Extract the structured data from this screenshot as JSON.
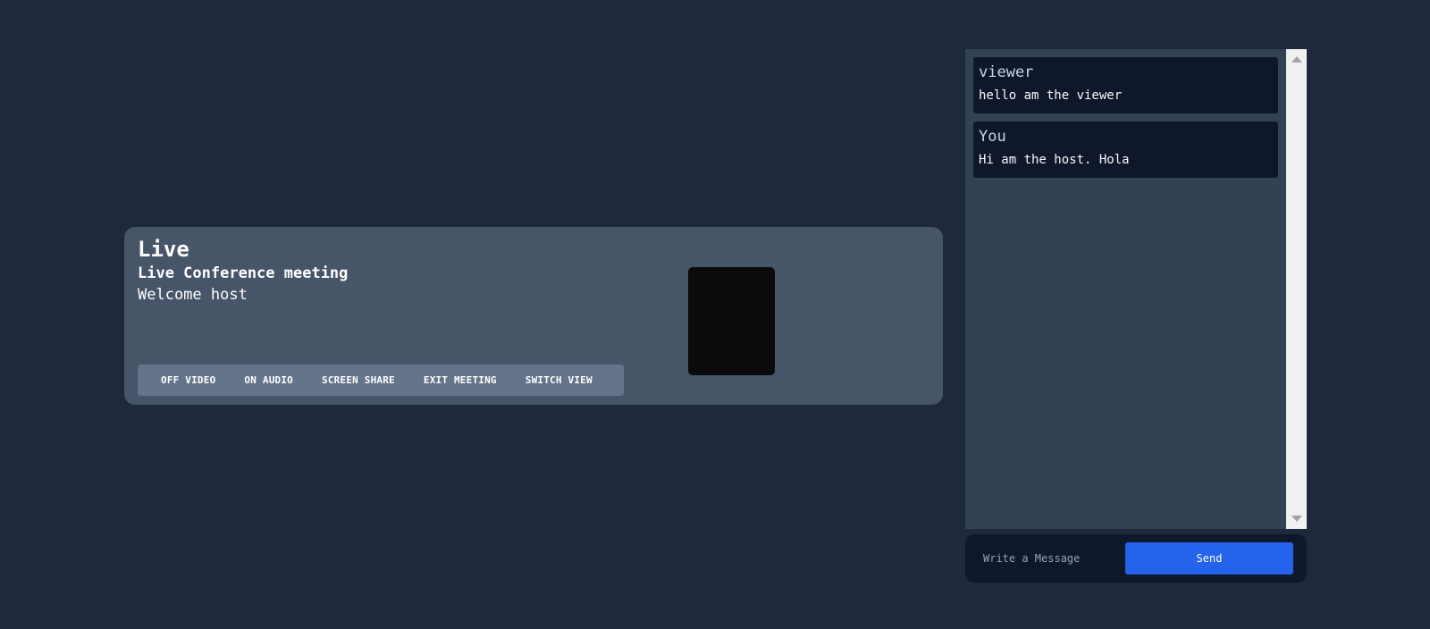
{
  "meeting": {
    "title": "Live",
    "subtitle": "Live Conference meeting",
    "welcome": "Welcome host",
    "controls": {
      "video": "OFF VIDEO",
      "audio": "ON AUDIO",
      "screen_share": "SCREEN SHARE",
      "exit": "EXIT MEETING",
      "switch_view": "SWITCH VIEW"
    }
  },
  "chat": {
    "messages": [
      {
        "author": "viewer",
        "text": "hello am the viewer"
      },
      {
        "author": "You",
        "text": "Hi am the host. Hola"
      }
    ],
    "input_placeholder": "Write a Message",
    "send_label": "Send"
  },
  "colors": {
    "page_background": "#1e293b",
    "meeting_card": "#475569",
    "controls_bar": "#64748b",
    "chat_panel": "#334155",
    "message_card": "#0f172a",
    "send_button": "#2563eb"
  }
}
